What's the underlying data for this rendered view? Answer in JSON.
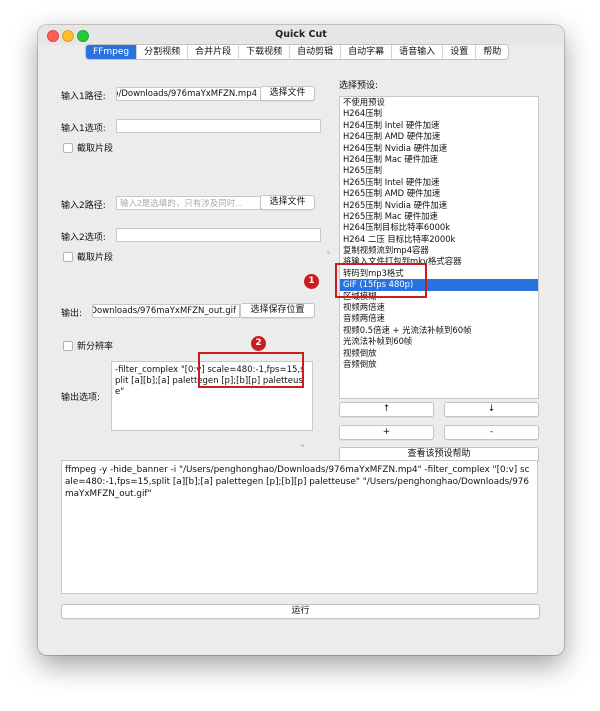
{
  "window": {
    "title": "Quick Cut"
  },
  "tabs": [
    "FFmpeg",
    "分割视频",
    "合并片段",
    "下载视频",
    "自动剪辑",
    "自动字幕",
    "语音输入",
    "设置",
    "帮助"
  ],
  "left": {
    "input1_label": "输入1路径:",
    "input1_value": "/Users/penghonghao/Downloads/976maYxMFZN.mp4",
    "choose_file": "选择文件",
    "input1_options_label": "输入1选项:",
    "input1_options_value": "",
    "clip_label": "截取片段",
    "input2_label": "输入2路径:",
    "input2_placeholder": "输入2是选填的，只有涉及同时...",
    "input2_options_label": "输入2选项:",
    "input2_options_value": "",
    "output_label": "输出:",
    "output_value": "/Users/penghonghao/Downloads/976maYxMFZN_out.gif",
    "choose_save": "选择保存位置",
    "new_resolution_label": "新分辨率",
    "output_options_label": "输出选项:",
    "output_options_value": "-filter_complex \"[0:v] scale=480:-1,fps=15,split [a][b];[a] palettegen [p];[b][p] paletteuse\""
  },
  "right": {
    "presets_label": "选择预设:",
    "presets": [
      "不使用预设",
      "H264压制",
      "H264压制 Intel 硬件加速",
      "H264压制 AMD 硬件加速",
      "H264压制 Nvidia 硬件加速",
      "H264压制 Mac 硬件加速",
      "H265压制",
      "H265压制 Intel 硬件加速",
      "H265压制 AMD 硬件加速",
      "H265压制 Nvidia 硬件加速",
      "H265压制 Mac 硬件加速",
      "H264压制目标比特率6000k",
      "H264 二压 目标比特率2000k",
      "复制视频流到mp4容器",
      "将输入文件打包到mkv格式容器",
      "转码到mp3格式",
      "GIF (15fps 480p)",
      "区域模糊",
      "视频两倍速",
      "音频两倍速",
      "视频0.5倍速 + 光流法补帧到60帧",
      "光流法补帧到60帧",
      "视频倒放",
      "音频倒放"
    ],
    "selected_index": 16,
    "up": "↑",
    "down": "↓",
    "add": "+",
    "remove": "-",
    "help": "查看该预设帮助"
  },
  "command": "ffmpeg -y -hide_banner -i \"/Users/penghonghao/Downloads/976maYxMFZN.mp4\" -filter_complex \"[0:v] scale=480:-1,fps=15,split [a][b];[a] palettegen [p];[b][p] paletteuse\" \"/Users/penghonghao/Downloads/976maYxMFZN_out.gif\"",
  "run": "运行",
  "annotations": [
    "1",
    "2"
  ],
  "colors": {
    "accent": "#2a72e0",
    "annotation": "#c81e1e"
  }
}
